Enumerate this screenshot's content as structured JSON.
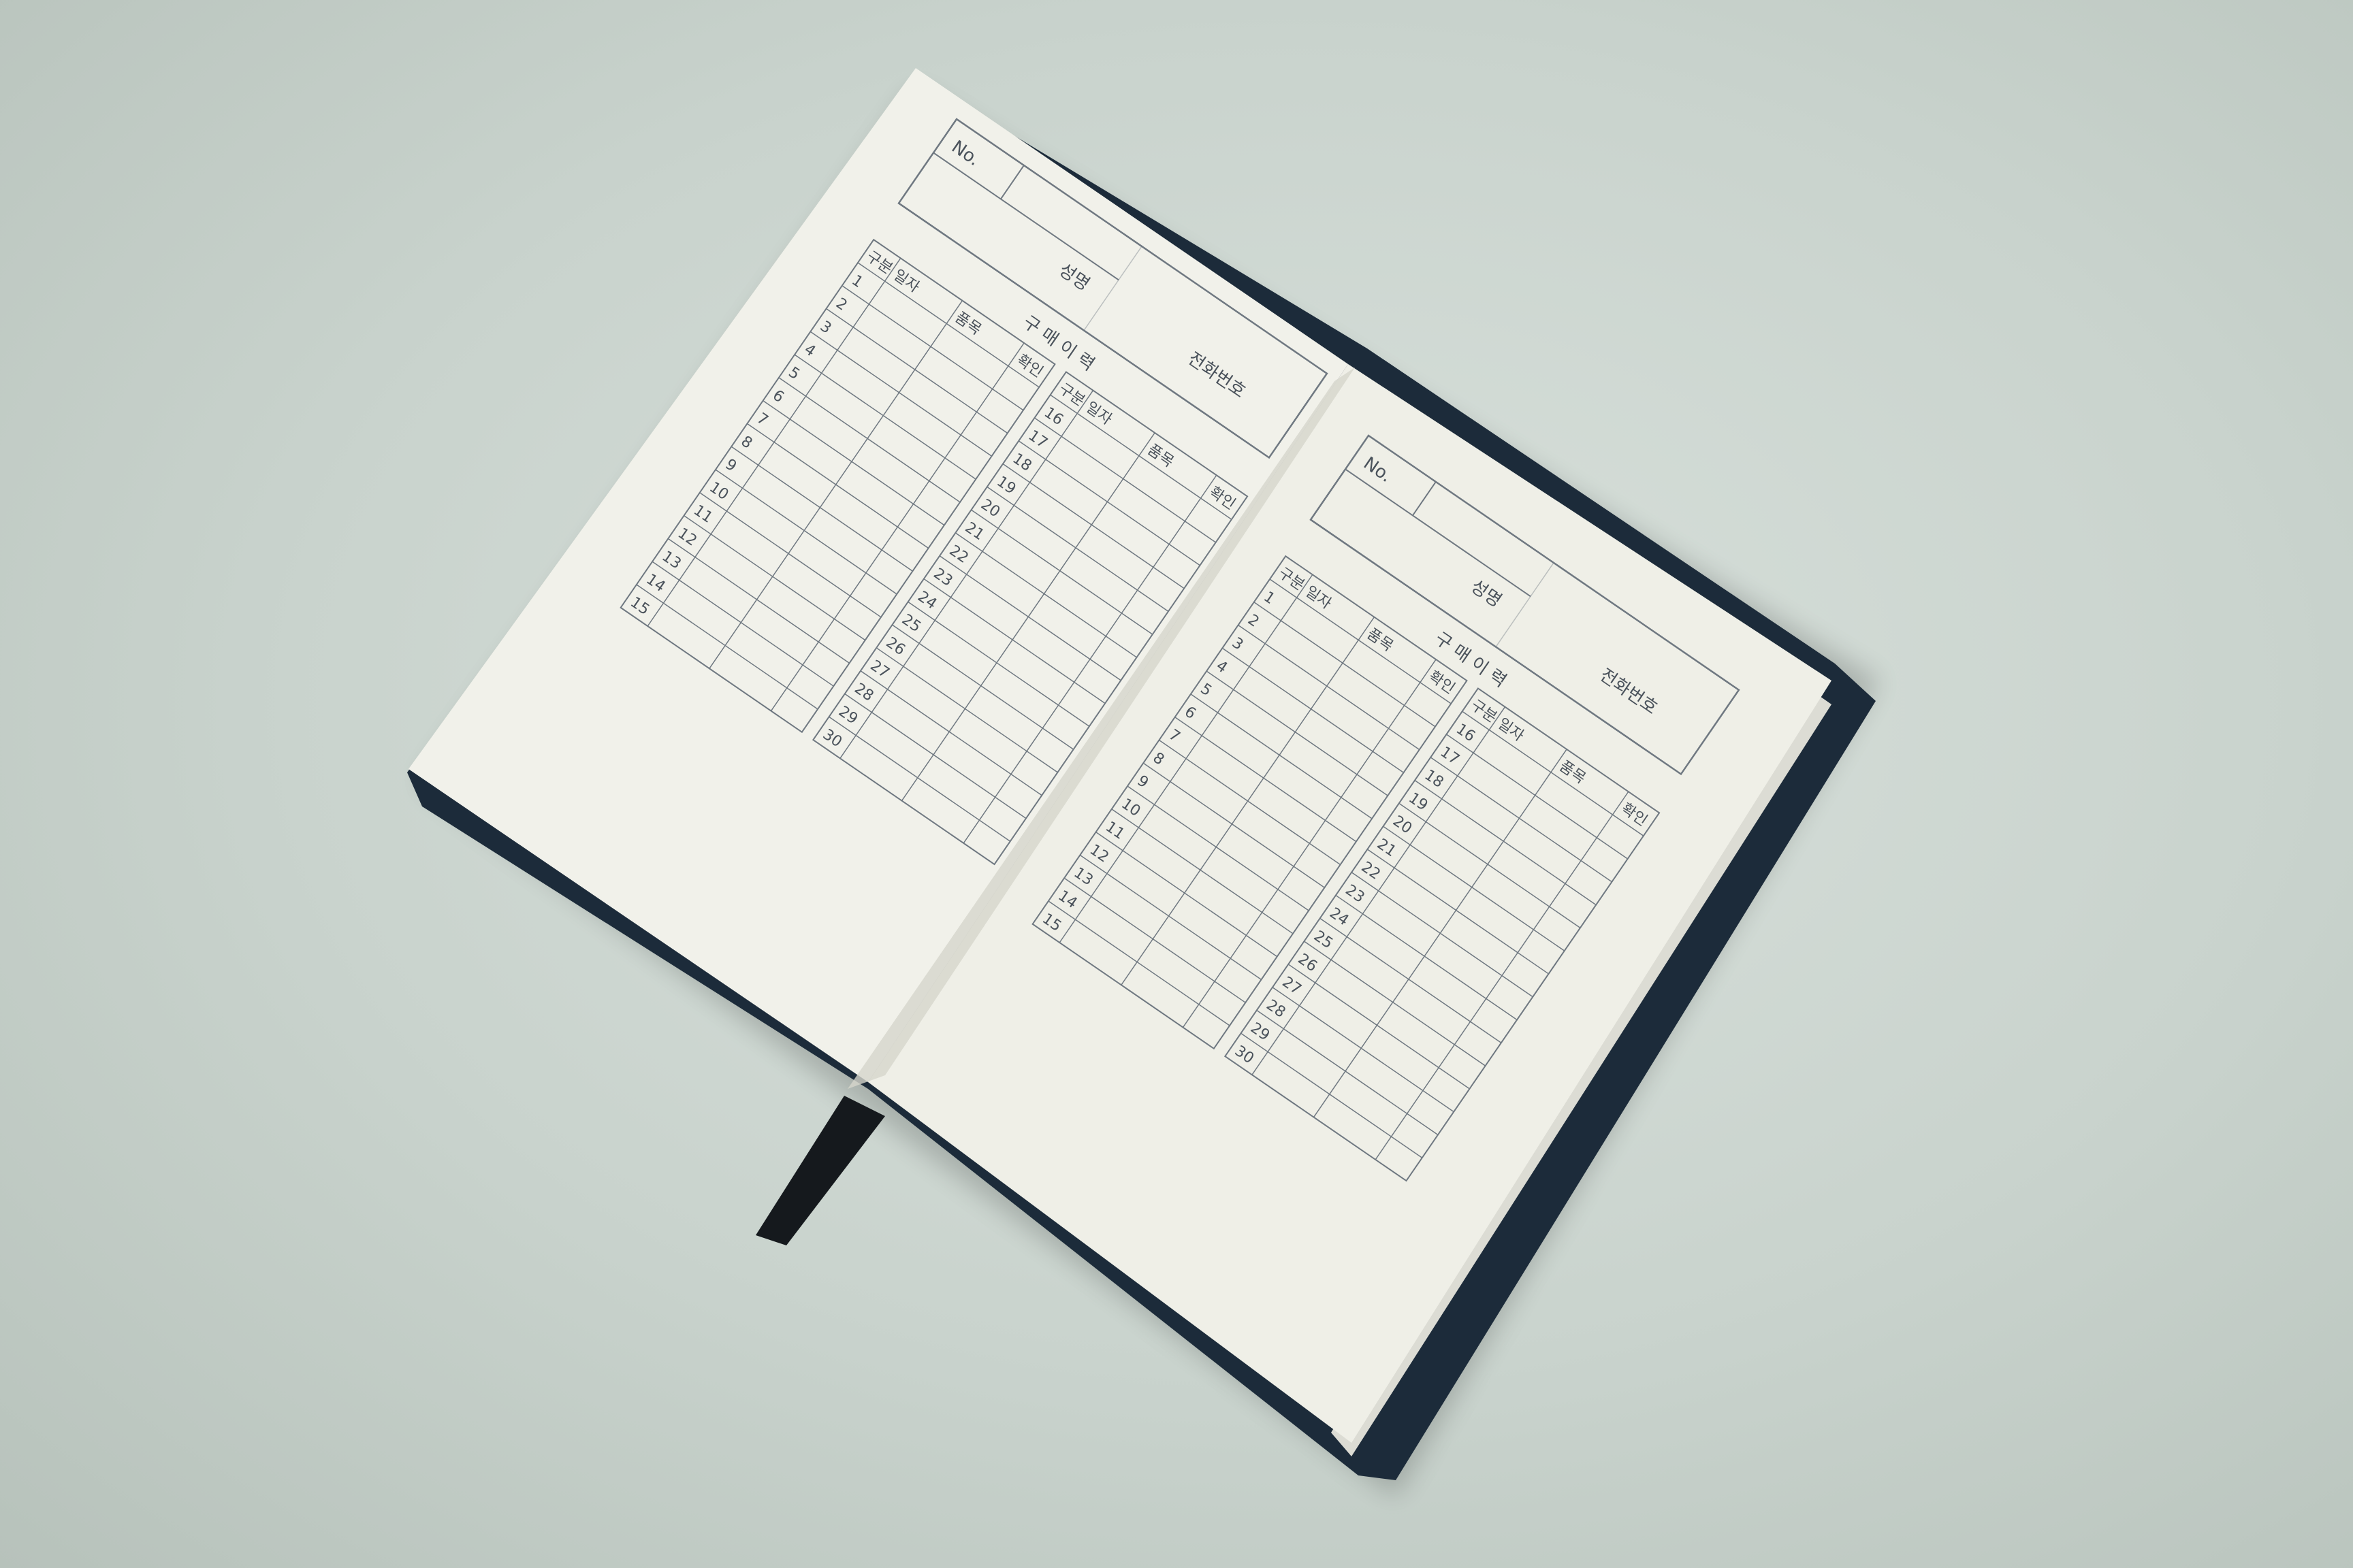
{
  "notebook": {
    "cover_color": "#1c2b3a",
    "paper_color": "#f1f1ea",
    "ink_color": "#4a525b",
    "pages": [
      {
        "no_label": "No.",
        "name_label": "성명",
        "phone_label": "전화번호",
        "section_title": "구 매 이 력",
        "columns_left": [
          "구분",
          "일자",
          "품목",
          "확인"
        ],
        "columns_right": [
          "구분",
          "일자",
          "품목",
          "확인"
        ],
        "rows_left": [
          "1",
          "2",
          "3",
          "4",
          "5",
          "6",
          "7",
          "8",
          "9",
          "10",
          "11",
          "12",
          "13",
          "14",
          "15"
        ],
        "rows_right": [
          "16",
          "17",
          "18",
          "19",
          "20",
          "21",
          "22",
          "23",
          "24",
          "25",
          "26",
          "27",
          "28",
          "29",
          "30"
        ]
      },
      {
        "no_label": "No.",
        "name_label": "성명",
        "phone_label": "전화번호",
        "section_title": "구 매 이 력",
        "columns_left": [
          "구분",
          "일자",
          "품목",
          "확인"
        ],
        "columns_right": [
          "구분",
          "일자",
          "품목",
          "확인"
        ],
        "rows_left": [
          "1",
          "2",
          "3",
          "4",
          "5",
          "6",
          "7",
          "8",
          "9",
          "10",
          "11",
          "12",
          "13",
          "14",
          "15"
        ],
        "rows_right": [
          "16",
          "17",
          "18",
          "19",
          "20",
          "21",
          "22",
          "23",
          "24",
          "25",
          "26",
          "27",
          "28",
          "29",
          "30"
        ]
      }
    ]
  }
}
